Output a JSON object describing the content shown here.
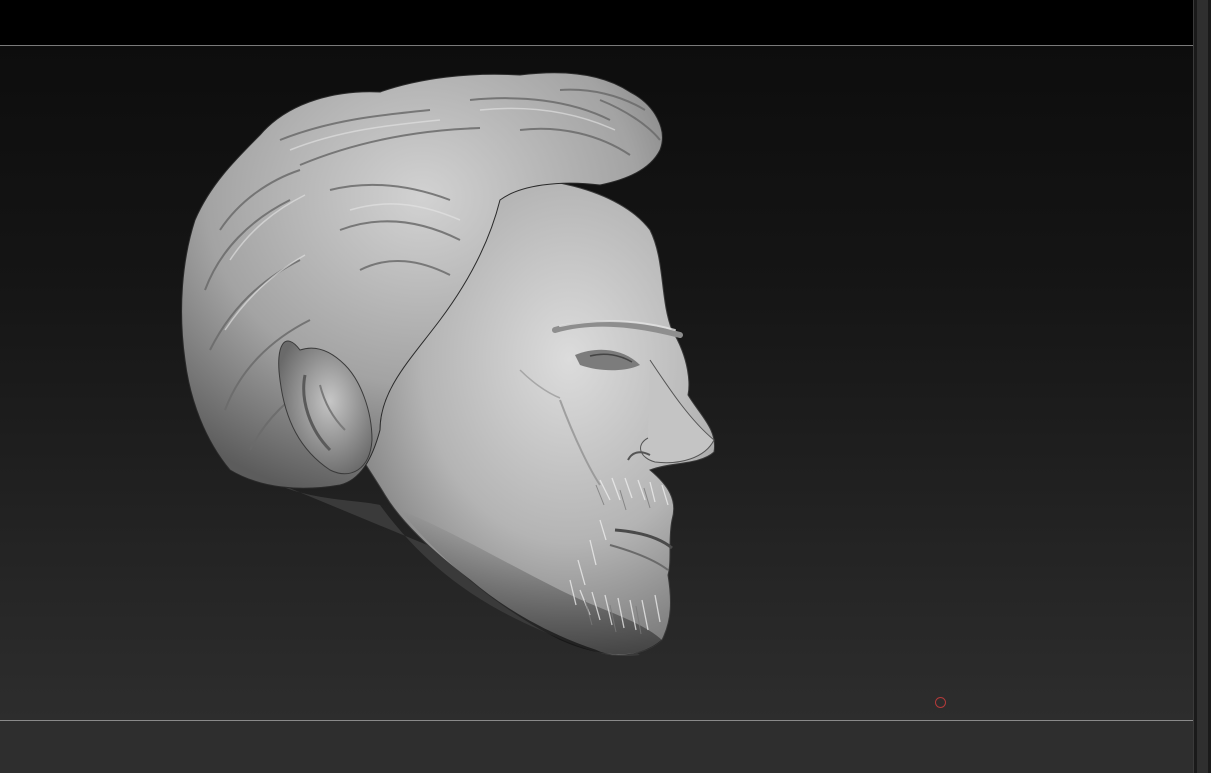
{
  "app": {
    "viewport_label": "",
    "model_name": ""
  },
  "colors": {
    "canvas_top": "#0d0d0d",
    "canvas_bottom": "#2d2d2d",
    "clay": "#b9b9b9",
    "cursor": "#b23a3a"
  },
  "icons": {
    "cursor": "brush-cursor-circle-icon"
  }
}
